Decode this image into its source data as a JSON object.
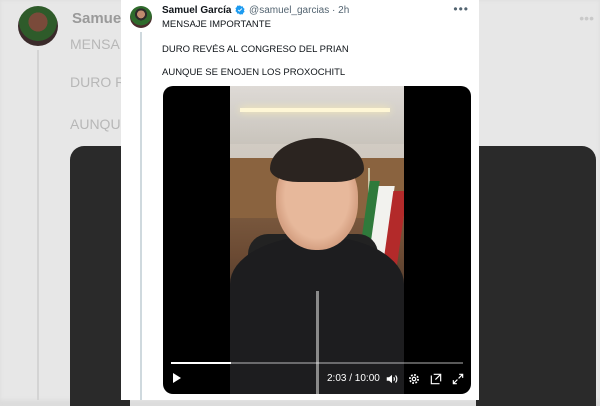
{
  "author": {
    "display_name": "Samuel García",
    "handle": "@samuel_garcias",
    "separator": "·",
    "time": "2h",
    "verified": true
  },
  "tweet": {
    "lines": [
      "MENSAJE IMPORTANTE",
      "DURO REVÉS AL CONGRESO DEL PRIAN",
      "AUNQUE SE ENOJEN LOS PROXOCHITL"
    ]
  },
  "video": {
    "time_readout": "2:03 / 10:00",
    "progress": 0.205
  },
  "background": {
    "name": "Samuel",
    "line1": "MENSA",
    "line2": "DURO R",
    "line3": "AUNQU"
  },
  "colors": {
    "accent": "#1d9bf0",
    "text": "#0f1419",
    "muted": "#536471"
  },
  "icons": [
    "verified-badge-icon",
    "more-icon",
    "play-icon",
    "volume-icon",
    "settings-icon",
    "picture-in-picture-icon",
    "fullscreen-icon"
  ]
}
